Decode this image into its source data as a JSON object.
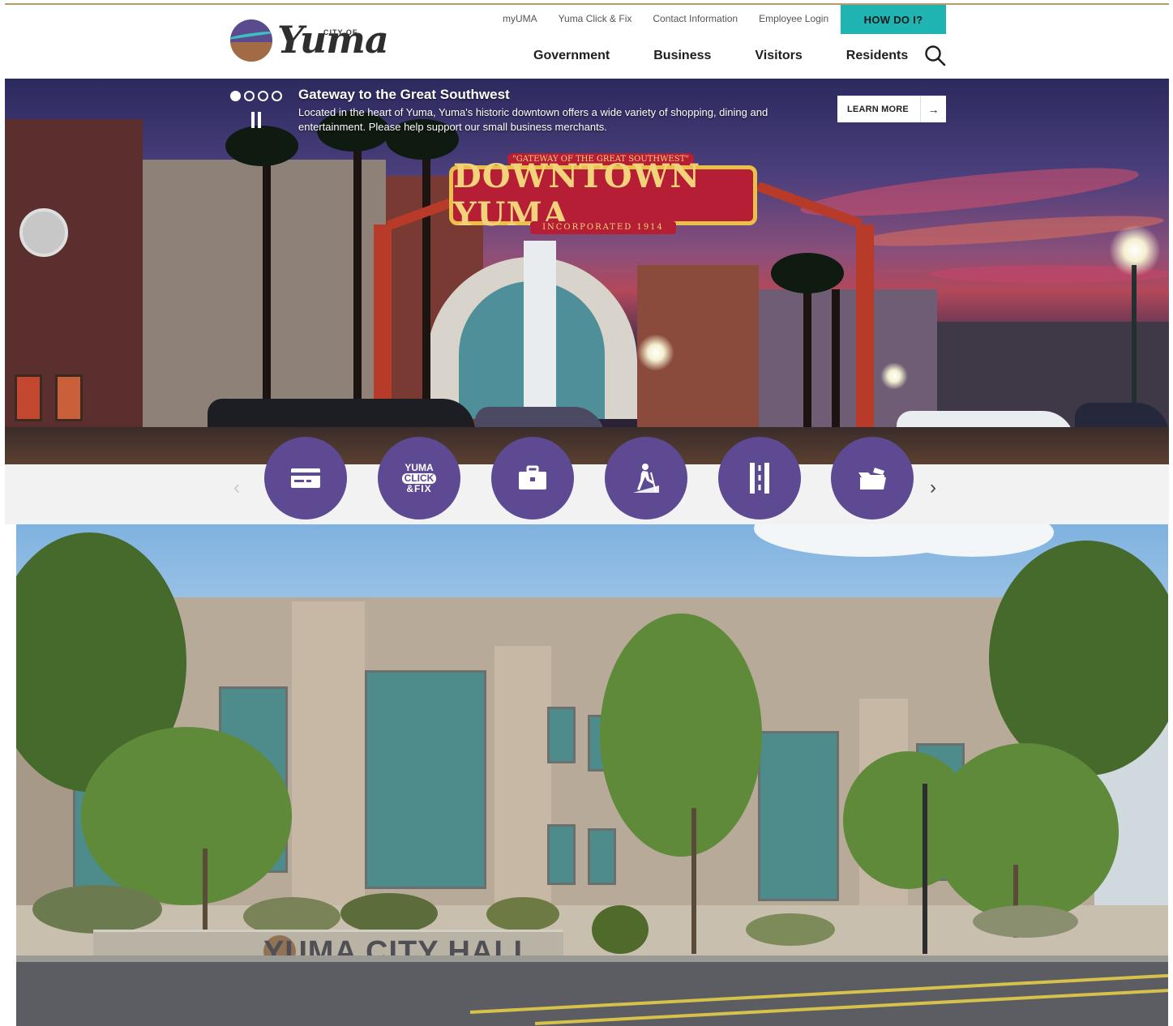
{
  "header": {
    "logo": {
      "small_text": "CITY OF",
      "script_text": "Yuma"
    },
    "utility_links": [
      "myUMA",
      "Yuma Click & Fix",
      "Contact Information",
      "Employee Login"
    ],
    "cta_label": "HOW DO I?",
    "main_nav": [
      "Government",
      "Business",
      "Visitors",
      "Residents"
    ],
    "search_icon": "search-icon"
  },
  "hero": {
    "title": "Gateway to the Great Southwest",
    "description": "Located in the heart of Yuma, Yuma's historic downtown offers a wide variety of shopping, dining and entertainment. Please help support our small business merchants.",
    "learn_more_label": "LEARN MORE",
    "learn_more_arrow": "→",
    "slide_count": 4,
    "active_slide": 1,
    "pause_icon": "pause-icon",
    "image_sign": {
      "top": "\"GATEWAY OF THE GREAT SOUTHWEST\"",
      "main": "DOWNTOWN YUMA",
      "bottom": "INCORPORATED 1914"
    }
  },
  "quick_links": {
    "prev_arrow": "‹",
    "next_arrow": "›",
    "items": [
      {
        "icon": "payment-card-icon"
      },
      {
        "icon": "yuma-click-fix-icon",
        "text_lines": [
          "YUMA",
          "CLICK",
          "&FIX"
        ]
      },
      {
        "icon": "briefcase-icon"
      },
      {
        "icon": "hiker-icon"
      },
      {
        "icon": "road-icon"
      },
      {
        "icon": "open-folder-icon"
      }
    ]
  },
  "city_hall": {
    "sign_text": "YUMA CITY HALL"
  },
  "colors": {
    "accent_teal": "#1fb3b1",
    "brand_purple": "#5d4a93",
    "nav_text": "#1e1e1e"
  }
}
